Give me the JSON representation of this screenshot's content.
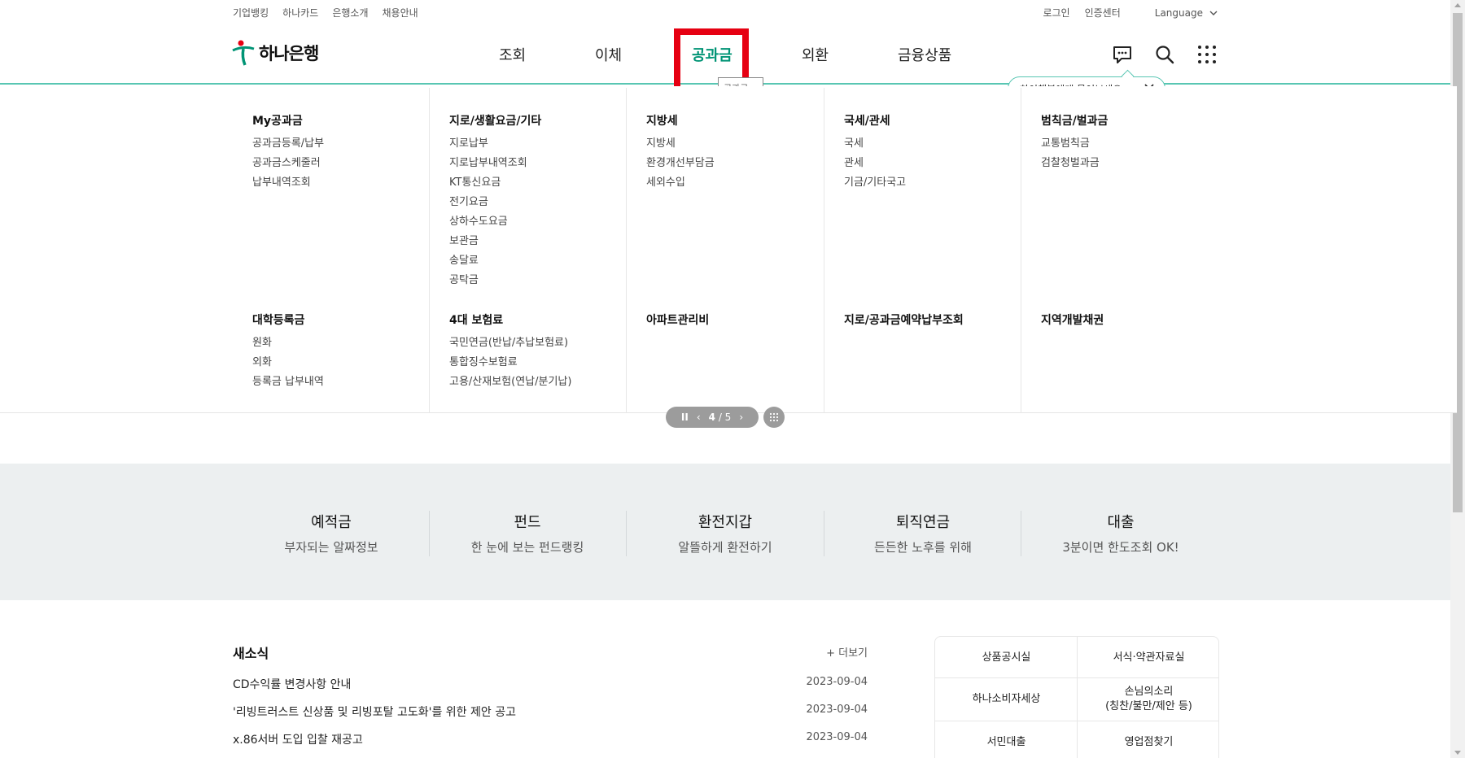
{
  "util": {
    "left": [
      "기업뱅킹",
      "하나카드",
      "은행소개",
      "채용안내"
    ],
    "login": "로그인",
    "cert": "인증센터",
    "language": "Language"
  },
  "header": {
    "logo_text": "하나은행",
    "gnb": [
      "조회",
      "이체",
      "공과금",
      "외환",
      "금융상품"
    ],
    "active_index": 2,
    "tooltip": "공과금",
    "chat_prompt": "하이챗봇에게 물어보세요~",
    "brand_color": "#009475",
    "highlight_color": "#e60012"
  },
  "mega_menu": {
    "columns": [
      {
        "groups": [
          {
            "title": "My공과금",
            "items": [
              "공과금등록/납부",
              "공과금스케줄러",
              "납부내역조회"
            ]
          },
          {
            "title": "대학등록금",
            "items": [
              "원화",
              "외화",
              "등록금 납부내역"
            ]
          }
        ]
      },
      {
        "groups": [
          {
            "title": "지로/생활요금/기타",
            "items": [
              "지로납부",
              "지로납부내역조회",
              "KT통신요금",
              "전기요금",
              "상하수도요금",
              "보관금",
              "송달료",
              "공탁금"
            ]
          },
          {
            "title": "4대 보험료",
            "items": [
              "국민연금(반납/추납보험료)",
              "통합징수보험료",
              "고용/산재보험(연납/분기납)"
            ]
          }
        ]
      },
      {
        "groups": [
          {
            "title": "지방세",
            "items": [
              "지방세",
              "환경개선부담금",
              "세외수입"
            ]
          },
          {
            "title": "아파트관리비",
            "items": []
          }
        ]
      },
      {
        "groups": [
          {
            "title": "국세/관세",
            "items": [
              "국세",
              "관세",
              "기금/기타국고"
            ]
          },
          {
            "title": "지로/공과금예약납부조회",
            "items": []
          }
        ]
      },
      {
        "groups": [
          {
            "title": "범칙금/벌과금",
            "items": [
              "교통범칙금",
              "검찰청벌과금"
            ]
          },
          {
            "title": "지역개발채권",
            "items": []
          }
        ]
      }
    ]
  },
  "slider": {
    "pause": "II",
    "page": "4",
    "total": "/ 5"
  },
  "quick": [
    {
      "title": "예적금",
      "sub": "부자되는 알짜정보"
    },
    {
      "title": "펀드",
      "sub": "한 눈에 보는 펀드랭킹"
    },
    {
      "title": "환전지갑",
      "sub": "알뜰하게 환전하기"
    },
    {
      "title": "퇴직연금",
      "sub": "든든한 노후를 위해"
    },
    {
      "title": "대출",
      "sub": "3분이면 한도조회 OK!"
    }
  ],
  "news": {
    "title": "새소식",
    "more": "+ 더보기",
    "rows": [
      {
        "text": "CD수익률 변경사항 안내",
        "date": "2023-09-04"
      },
      {
        "text": "'리빙트러스트 신상품 및 리빙포탈 고도화'를 위한 제안 공고",
        "date": "2023-09-04"
      },
      {
        "text": "x.86서버 도입 입찰 재공고",
        "date": "2023-09-04"
      }
    ]
  },
  "links": [
    {
      "label": "상품공시실"
    },
    {
      "label": "서식·약관자료실"
    },
    {
      "label": "하나소비자세상"
    },
    {
      "label": "손님의소리\n(칭찬/불만/제안 등)"
    },
    {
      "label": "서민대출"
    },
    {
      "label": "영업점찾기"
    }
  ]
}
